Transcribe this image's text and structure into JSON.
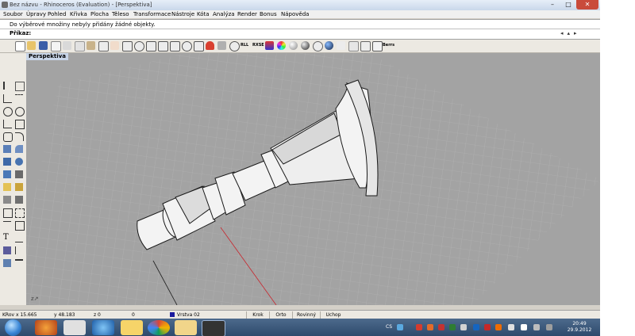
{
  "window": {
    "title": "Bez názvu - Rhinoceros (Evaluation) - [Perspektiva]",
    "controls": {
      "minimize": "–",
      "maximize": "□",
      "close": "✕"
    }
  },
  "menu": [
    "Soubor",
    "Úpravy",
    "Pohled",
    "Křivka",
    "Plocha",
    "Těleso",
    "Transformace",
    "Nástroje",
    "Kóta",
    "Analýza",
    "Render",
    "Bonus",
    "Nápověda"
  ],
  "command": {
    "history": "Do výběrové množiny nebyly přidány žádné objekty.",
    "prompt": "Příkaz:",
    "value": ""
  },
  "toolbar": {
    "labels": [
      "RLL",
      "RXSE",
      "Berrs"
    ]
  },
  "viewport": {
    "label": "Perspektiva"
  },
  "status": {
    "cplane": "KRov",
    "x": "x 15.665",
    "y": "y 48.183",
    "z": "z 0",
    "distance": "0",
    "layer": "Vrstva 02",
    "layer_color": "#1a1a9e",
    "buttons": [
      "Krok",
      "Orto",
      "Rovinný",
      "Uchop"
    ]
  },
  "taskbar": {
    "tray_lang": "CS",
    "time": "20:49",
    "date": "29.9.2012"
  }
}
